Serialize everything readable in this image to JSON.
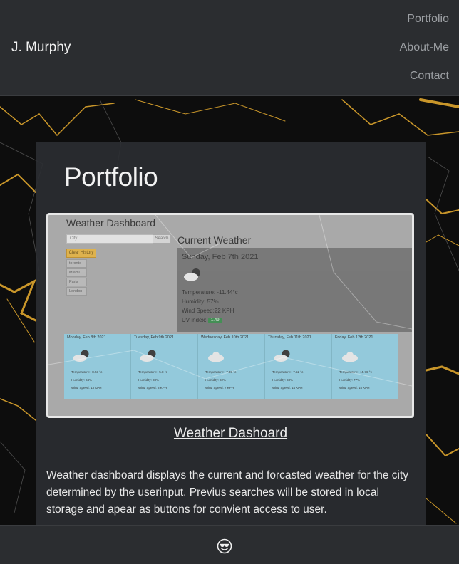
{
  "header": {
    "brand": "J. Murphy",
    "nav": [
      "Portfolio",
      "About-Me",
      "Contact"
    ]
  },
  "main": {
    "heading": "Portfolio",
    "project": {
      "title": "Weather Dashoard",
      "description": "Weather dashboard displays the current and forcasted weather for the city determined by the userinput. Previus searches will be stored in local storage and apear as buttons for convient access to user.",
      "screenshot": {
        "app_title": "Weather Dashboard",
        "search_placeholder": "City",
        "search_button": "Search",
        "clear_history": "Clear History",
        "cities": [
          "toronto",
          "Miami",
          "Paris",
          "London"
        ],
        "current_title": "Current Weather",
        "current": {
          "date": "Sunday, Feb 7th 2021",
          "temperature": "Temperature: -11.44°c",
          "humidity": "Humidity: 57%",
          "wind": "Wind Speed:22 KPH",
          "uv_label": "UV index:",
          "uv_value": "1.49"
        },
        "forecast": [
          {
            "date": "Monday, Feb 8th 2021",
            "temp": "Temperature: -8.53 °c",
            "humidity": "Humidity: 84%",
            "wind": "Wind Speed: 13 KPH",
            "icon": "partly-cloudy"
          },
          {
            "date": "Tuesday, Feb 9th 2021",
            "temp": "Temperature: -5.8 °c",
            "humidity": "Humidity: 88%",
            "wind": "Wind Speed: 8 KPH",
            "icon": "partly-cloudy"
          },
          {
            "date": "Wednesday, Feb 10th 2021",
            "temp": "Temperature: -7.39 °c",
            "humidity": "Humidity: 82%",
            "wind": "Wind Speed: 7 KPH",
            "icon": "cloud"
          },
          {
            "date": "Thursday, Feb 11th 2021",
            "temp": "Temperature: -7.52 °c",
            "humidity": "Humidity: 83%",
            "wind": "Wind Speed: 14 KPH",
            "icon": "partly-cloudy"
          },
          {
            "date": "Friday, Feb 12th 2021",
            "temp": "Temperature: -15.76 °c",
            "humidity": "Humidity: 77%",
            "wind": "Wind Speed: 15 KPH",
            "icon": "cloud"
          }
        ]
      }
    }
  },
  "footer": {
    "icon": "sunglasses-smiley-icon"
  },
  "colors": {
    "header_bg": "#2b2d30",
    "card_bg": "#2b2d31",
    "marble_gold": "#d4a531",
    "uv_badge": "#2f8a43",
    "forecast_bg": "#8fd1e6"
  }
}
